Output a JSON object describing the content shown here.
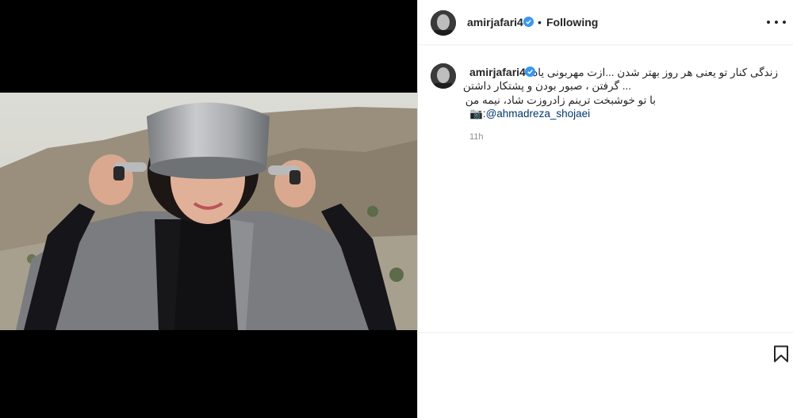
{
  "post": {
    "username": "amirjafari4",
    "follow_status": "Following",
    "dot": "•",
    "caption_lines": [
      "زندگی کنار تو یعنی هر روز بهتر شدن ...ازت مهربونی یاد",
      "... گرفتن ، صبور بودن و پشتکار داشتن",
      "با تو خوشبخت ترینم زادروزت شاد، نیمه من"
    ],
    "camera_emoji": "📷",
    "mention_prefix": ":",
    "mention": "@ahmadreza_shojaei",
    "time": "11h"
  },
  "icons": [
    "verified-badge-icon",
    "more-options-icon",
    "bookmark-icon"
  ],
  "colors": {
    "verified": "#3897f0",
    "mention": "#00376b",
    "muted": "#8e8e8e"
  }
}
